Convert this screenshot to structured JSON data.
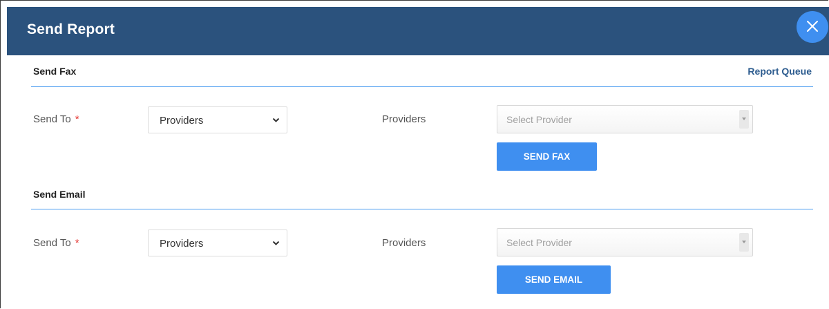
{
  "dialog": {
    "title": "Send Report",
    "close_icon": "close-icon"
  },
  "fax": {
    "section_title": "Send Fax",
    "report_queue_link": "Report Queue",
    "send_to_label": "Send To",
    "required_marker": "*",
    "send_to_value": "Providers",
    "providers_label": "Providers",
    "provider_placeholder": "Select Provider",
    "send_button": "SEND FAX"
  },
  "email": {
    "section_title": "Send Email",
    "send_to_label": "Send To",
    "required_marker": "*",
    "send_to_value": "Providers",
    "providers_label": "Providers",
    "provider_placeholder": "Select Provider",
    "send_button": "SEND EMAIL"
  },
  "colors": {
    "header_bg": "#2b527d",
    "accent": "#3f8ff0",
    "link": "#2d5c8f",
    "required": "#e53935"
  }
}
